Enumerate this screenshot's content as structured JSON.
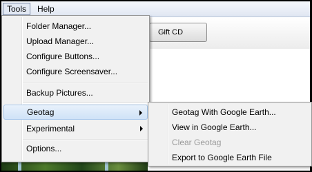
{
  "menubar": {
    "items": [
      {
        "label": "Tools"
      },
      {
        "label": "Help"
      }
    ]
  },
  "toolbar": {
    "gift_label": "Gift CD"
  },
  "tools_menu": {
    "items": [
      {
        "label": "Folder Manager..."
      },
      {
        "label": "Upload Manager..."
      },
      {
        "label": "Configure Buttons..."
      },
      {
        "label": "Configure Screensaver..."
      },
      {
        "label": "Backup Pictures..."
      },
      {
        "label": "Geotag"
      },
      {
        "label": "Experimental"
      },
      {
        "label": "Options..."
      }
    ],
    "highlighted": "Geotag"
  },
  "geotag_submenu": {
    "items": [
      {
        "label": "Geotag With Google Earth...",
        "enabled": true
      },
      {
        "label": "View in Google Earth...",
        "enabled": true
      },
      {
        "label": "Clear Geotag",
        "enabled": false
      },
      {
        "label": "Export to Google Earth File",
        "enabled": true
      }
    ]
  },
  "colors": {
    "menu_background": "#f1f1f1",
    "highlight": "#cfe2f7",
    "disabled_text": "#9a9a9a"
  },
  "icons": {
    "submenu_arrow": "chevron-right-icon"
  }
}
